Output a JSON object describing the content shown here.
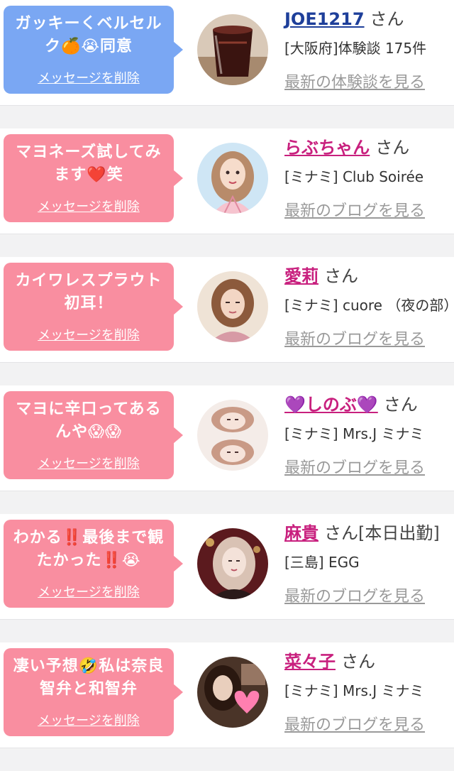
{
  "colors": {
    "bubble_blue": "#7aa7f3",
    "bubble_pink": "#f98ea0",
    "name_blue": "#1e3f9a",
    "name_pink": "#c8207e"
  },
  "delete_label": "メッセージを削除",
  "san_label": "さん",
  "items": [
    {
      "bubble_color": "blue",
      "message": "ガッキーくベルセルク🍊😭同意",
      "name": "JOE1217",
      "name_color": "blue",
      "shop": "[大阪府]体験談 175件",
      "status": "",
      "more_link": "最新の体験談を見る",
      "avatar_icon": "drink-glass-photo"
    },
    {
      "bubble_color": "pink",
      "message": "マヨネーズ試してみます❤️笑",
      "name": "らぶちゃん",
      "name_color": "pink",
      "shop": "[ミナミ] Club Soirée",
      "status": "",
      "more_link": "最新のブログを見る",
      "avatar_icon": "cartoon-girl-illustration"
    },
    {
      "bubble_color": "pink",
      "message": "カイワレスプラウト初耳！",
      "name": "愛莉",
      "name_color": "pink",
      "shop": "[ミナミ] cuore （夜の部）",
      "status": "",
      "more_link": "最新のブログを見る",
      "avatar_icon": "woman-photo"
    },
    {
      "bubble_color": "pink",
      "message": "マヨに辛口ってあるんや😱😱",
      "name": "💜しのぶ💜",
      "name_color": "pink",
      "shop": "[ミナミ] Mrs.J ミナミ",
      "status": "",
      "more_link": "最新のブログを見る",
      "avatar_icon": "woman-photo"
    },
    {
      "bubble_color": "pink",
      "message": "わかる‼️最後まで観たかった‼️😭",
      "name": "麻貴",
      "name_color": "pink",
      "shop": "[三島] EGG",
      "status": "[本日出勤]",
      "more_link": "最新のブログを見る",
      "avatar_icon": "woman-photo"
    },
    {
      "bubble_color": "pink",
      "message": "凄い予想🤣私は奈良智弁と和智弁",
      "name": "菜々子",
      "name_color": "pink",
      "shop": "[ミナミ] Mrs.J ミナミ",
      "status": "",
      "more_link": "最新のブログを見る",
      "avatar_icon": "heart-photo"
    }
  ]
}
